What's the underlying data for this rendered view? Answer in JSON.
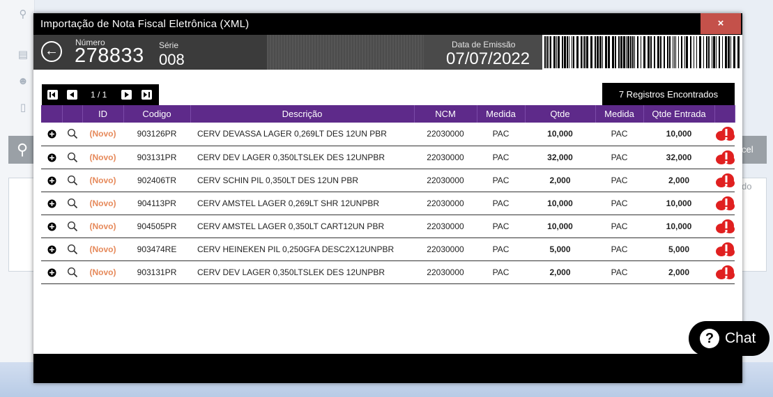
{
  "modal": {
    "title": "Importação de Nota Fiscal Eletrônica (XML)",
    "close_label": "×"
  },
  "header": {
    "numero_label": "Número",
    "numero_value": "278833",
    "serie_label": "Série",
    "serie_value": "008",
    "data_label": "Data de Emissão",
    "data_value": "07/07/2022"
  },
  "pager": {
    "page_label": "1 / 1"
  },
  "records_count": "7 Registros Encontrados",
  "table": {
    "columns": [
      "",
      "",
      "ID",
      "Codigo",
      "Descrição",
      "NCM",
      "Medida",
      "Qtde",
      "Medida",
      "Qtde Entrada",
      ""
    ],
    "rows": [
      {
        "id": "(Novo)",
        "codigo": "903126PR",
        "descricao": "CERV DEVASSA LAGER 0,269LT DES 12UN PBR",
        "ncm": "22030000",
        "medida": "PAC",
        "qtde": "10,000",
        "medida2": "PAC",
        "qtde_entrada": "10,000"
      },
      {
        "id": "(Novo)",
        "codigo": "903131PR",
        "descricao": "CERV DEV LAGER 0,350LTSLEK DES 12UNPBR",
        "ncm": "22030000",
        "medida": "PAC",
        "qtde": "32,000",
        "medida2": "PAC",
        "qtde_entrada": "32,000"
      },
      {
        "id": "(Novo)",
        "codigo": "902406TR",
        "descricao": "CERV SCHIN PIL 0,350LT DES 12UN PBR",
        "ncm": "22030000",
        "medida": "PAC",
        "qtde": "2,000",
        "medida2": "PAC",
        "qtde_entrada": "2,000"
      },
      {
        "id": "(Novo)",
        "codigo": "904113PR",
        "descricao": "CERV AMSTEL LAGER 0,269LT SHR 12UNPBR",
        "ncm": "22030000",
        "medida": "PAC",
        "qtde": "10,000",
        "medida2": "PAC",
        "qtde_entrada": "10,000"
      },
      {
        "id": "(Novo)",
        "codigo": "904505PR",
        "descricao": "CERV AMSTEL LAGER 0,350LT CART12UN PBR",
        "ncm": "22030000",
        "medida": "PAC",
        "qtde": "10,000",
        "medida2": "PAC",
        "qtde_entrada": "10,000"
      },
      {
        "id": "(Novo)",
        "codigo": "903474RE",
        "descricao": "CERV HEINEKEN PIL 0,250GFA DESC2X12UNPBR",
        "ncm": "22030000",
        "medida": "PAC",
        "qtde": "5,000",
        "medida2": "PAC",
        "qtde_entrada": "5,000"
      },
      {
        "id": "(Novo)",
        "codigo": "903131PR",
        "descricao": "CERV DEV LAGER 0,350LTSLEK DES 12UNPBR",
        "ncm": "22030000",
        "medida": "PAC",
        "qtde": "2,000",
        "medida2": "PAC",
        "qtde_entrada": "2,000"
      }
    ]
  },
  "background": {
    "right_btn_label": "cel",
    "right_btn2_label": "do"
  },
  "chat": {
    "label": "Chat"
  },
  "colors": {
    "header_purple": "#5e2a8a",
    "novo_orange": "#e6895a",
    "close_red": "#c4514a",
    "alert_red": "#e02020"
  }
}
